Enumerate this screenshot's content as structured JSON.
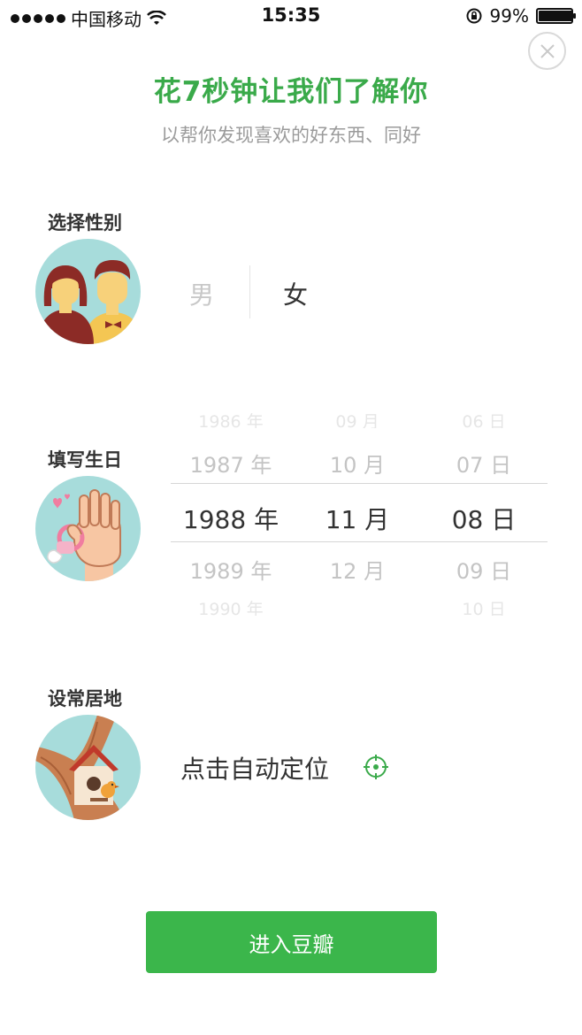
{
  "status_bar": {
    "carrier": "中国移动",
    "time": "15:35",
    "battery": "99%",
    "battery_level": 0.99,
    "icons": [
      "signal-dots-icon",
      "wifi-icon",
      "rotation-lock-icon",
      "battery-icon"
    ]
  },
  "header": {
    "close_icon": "close-icon",
    "title": "花7秒钟让我们了解你",
    "subtitle": "以帮你发现喜欢的好东西、同好"
  },
  "gender": {
    "label": "选择性别",
    "male": "男",
    "female": "女",
    "selected": "女"
  },
  "birthday": {
    "label": "填写生日",
    "year_unit": "年",
    "month_unit": "月",
    "day_unit": "日",
    "rows": [
      {
        "year": "1986",
        "month": "09",
        "day": "06"
      },
      {
        "year": "1987",
        "month": "10",
        "day": "07"
      },
      {
        "year": "1988",
        "month": "11",
        "day": "08"
      },
      {
        "year": "1989",
        "month": "12",
        "day": "09"
      },
      {
        "year": "1990",
        "month": "",
        "day": "10"
      }
    ],
    "selected_index": 2
  },
  "location": {
    "label": "设常居地",
    "action": "点击自动定位",
    "icon": "locate-icon"
  },
  "enter_button": "进入豆瓣",
  "colors": {
    "accent_green": "#3aaa4a",
    "button_green": "#3bb64b",
    "avatar_bg": "#a7dcdb"
  }
}
